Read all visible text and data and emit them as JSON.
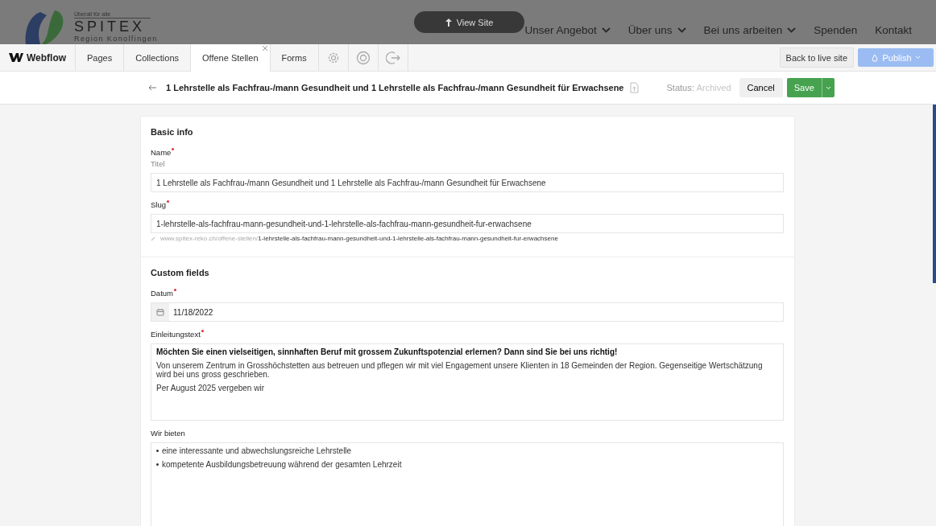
{
  "site_header": {
    "tagline": "Überall für alle",
    "logo_text": "SPITEX",
    "region": "Region Konolfingen",
    "view_site": "View Site",
    "nav": [
      {
        "label": "Unser Angebot",
        "dropdown": true
      },
      {
        "label": "Über uns",
        "dropdown": true
      },
      {
        "label": "Bei uns arbeiten",
        "dropdown": true
      },
      {
        "label": "Spenden",
        "dropdown": false
      },
      {
        "label": "Kontakt",
        "dropdown": false
      }
    ]
  },
  "toolbar": {
    "brand": "Webflow",
    "tabs": [
      {
        "label": "Pages",
        "selected": false,
        "closable": false
      },
      {
        "label": "Collections",
        "selected": false,
        "closable": false
      },
      {
        "label": "Offene Stellen",
        "selected": true,
        "closable": true
      },
      {
        "label": "Forms",
        "selected": false,
        "closable": false
      }
    ],
    "icon_tabs": [
      {
        "kind": "settings"
      },
      {
        "kind": "help"
      },
      {
        "kind": "logout"
      }
    ],
    "back_to_live": "Back to live site",
    "publish": "Publish"
  },
  "item_bar": {
    "title": "1 Lehrstelle als Fachfrau-/mann Gesundheit und 1 Lehrstelle als Fachfrau-/mann Gesundheit für Erwachsene",
    "status_label": "Status:",
    "status_value": "Archived",
    "cancel": "Cancel",
    "save": "Save"
  },
  "sections": [
    {
      "title": "Basic info",
      "fields": [
        {
          "kind": "text",
          "label": "Name",
          "required": true,
          "help": "Titel",
          "value": "1 Lehrstelle als Fachfrau-/mann Gesundheit und 1 Lehrstelle als Fachfrau-/mann Gesundheit für Erwachsene"
        },
        {
          "kind": "slug",
          "label": "Slug",
          "required": true,
          "value": "1-lehrstelle-als-fachfrau-mann-gesundheit-und-1-lehrstelle-als-fachfrau-mann-gesundheit-fur-erwachsene",
          "url_base": "www.spitex-reko.ch/offene-stellen/",
          "url_slug": "1-lehrstelle-als-fachfrau-mann-gesundheit-und-1-lehrstelle-als-fachfrau-mann-gesundheit-fur-erwachsene"
        }
      ]
    },
    {
      "title": "Custom fields",
      "fields": [
        {
          "kind": "date",
          "label": "Datum",
          "required": true,
          "value": "11/18/2022"
        },
        {
          "kind": "richtext",
          "label": "Einleitungstext",
          "required": true,
          "paragraphs": [
            {
              "text": "Möchten Sie einen vielseitigen, sinnhaften Beruf mit grossem Zukunftspotenzial erlernen? Dann sind Sie bei uns richtig!",
              "bold": true
            },
            {
              "text": "Von unserem Zentrum in Grosshöchstetten aus betreuen und pflegen wir mit viel Engagement unsere Klienten in 18 Gemeinden der Region. Gegenseitige Wertschätzung wird bei uns gross geschrieben.",
              "bold": false
            },
            {
              "text": "Per August 2025 vergeben wir",
              "bold": false
            }
          ]
        },
        {
          "kind": "list",
          "label": "Wir bieten",
          "required": false,
          "items": [
            "eine interessante und abwechslungsreiche Lehrstelle",
            "kompetente Ausbildungsbetreuung während der gesamten Lehrzeit"
          ]
        }
      ]
    }
  ]
}
